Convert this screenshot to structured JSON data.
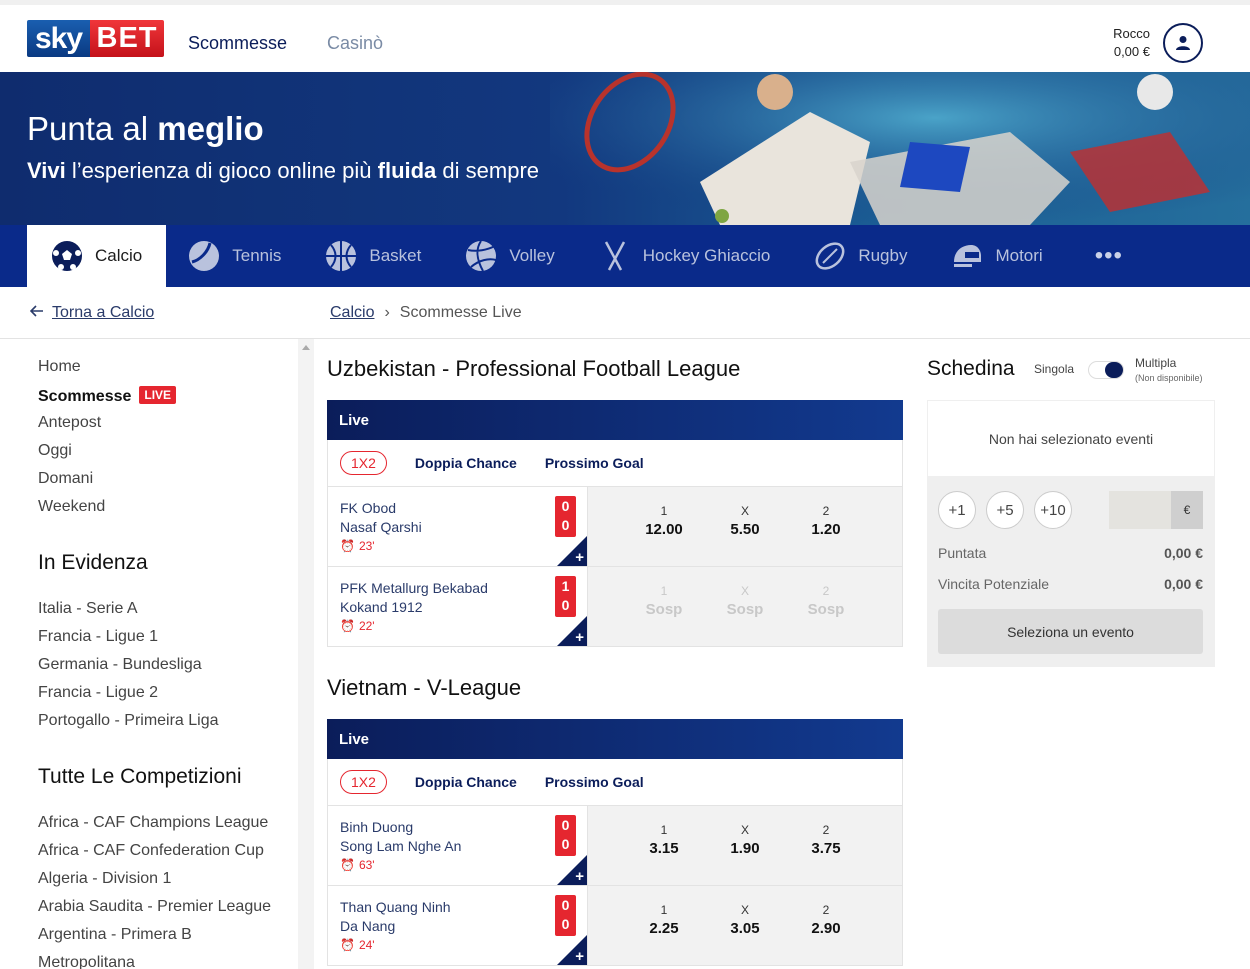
{
  "header": {
    "logo_sky": "sky",
    "logo_bet": "BET",
    "nav_scommesse": "Scommesse",
    "nav_casino": "Casinò",
    "user_name": "Rocco",
    "user_balance": "0,00 €"
  },
  "banner": {
    "title_regular": "Punta al ",
    "title_bold": "meglio",
    "sub_1": "Vivi",
    "sub_2": " l’esperienza di gioco online più ",
    "sub_3": "fluida",
    "sub_4": " di sempre"
  },
  "sports": [
    {
      "label": "Calcio",
      "icon": "football-icon",
      "active": true
    },
    {
      "label": "Tennis",
      "icon": "tennis-icon"
    },
    {
      "label": "Basket",
      "icon": "basketball-icon"
    },
    {
      "label": "Volley",
      "icon": "volleyball-icon"
    },
    {
      "label": "Hockey Ghiaccio",
      "icon": "hockey-icon"
    },
    {
      "label": "Rugby",
      "icon": "rugby-icon"
    },
    {
      "label": "Motori",
      "icon": "helmet-icon"
    }
  ],
  "sports_more": "•••",
  "breadcrumb": {
    "back": "Torna a Calcio",
    "crumb_1": "Calcio",
    "separator": "›",
    "crumb_2": "Scommesse Live"
  },
  "sidebar": {
    "items": [
      "Home",
      "Scommesse",
      "Antepost",
      "Oggi",
      "Domani",
      "Weekend"
    ],
    "live_badge": "LIVE",
    "heading_evidenza": "In Evidenza",
    "evidenza": [
      "Italia - Serie A",
      "Francia - Ligue 1",
      "Germania - Bundesliga",
      "Francia - Ligue 2",
      "Portogallo - Primeira Liga"
    ],
    "heading_tutte": "Tutte Le Competizioni",
    "competizioni": [
      "Africa - CAF Champions League",
      "Africa - CAF Confederation Cup",
      "Algeria - Division 1",
      "Arabia Saudita - Premier League",
      "Argentina - Primera B",
      "Metropolitana"
    ]
  },
  "tabs": {
    "t1": "1X2",
    "t2": "Doppia Chance",
    "t3": "Prossimo Goal"
  },
  "live_label": "Live",
  "leagues": [
    {
      "title": "Uzbekistan - Professional Football League",
      "matches": [
        {
          "home": "FK Obod",
          "away": "Nasaf Qarshi",
          "minute": "23'",
          "score_home": "0",
          "score_away": "0",
          "odds": [
            {
              "label": "1",
              "value": "12.00"
            },
            {
              "label": "X",
              "value": "5.50"
            },
            {
              "label": "2",
              "value": "1.20"
            }
          ],
          "suspended": false
        },
        {
          "home": "PFK Metallurg Bekabad",
          "away": "Kokand 1912",
          "minute": "22'",
          "score_home": "1",
          "score_away": "0",
          "odds": [
            {
              "label": "1",
              "value": "Sosp"
            },
            {
              "label": "X",
              "value": "Sosp"
            },
            {
              "label": "2",
              "value": "Sosp"
            }
          ],
          "suspended": true
        }
      ]
    },
    {
      "title": "Vietnam - V-League",
      "matches": [
        {
          "home": "Binh Duong",
          "away": "Song Lam Nghe An",
          "minute": "63'",
          "score_home": "0",
          "score_away": "0",
          "odds": [
            {
              "label": "1",
              "value": "3.15"
            },
            {
              "label": "X",
              "value": "1.90"
            },
            {
              "label": "2",
              "value": "3.75"
            }
          ],
          "suspended": false
        },
        {
          "home": "Than Quang Ninh",
          "away": "Da Nang",
          "minute": "24'",
          "score_home": "0",
          "score_away": "0",
          "odds": [
            {
              "label": "1",
              "value": "2.25"
            },
            {
              "label": "X",
              "value": "3.05"
            },
            {
              "label": "2",
              "value": "2.90"
            }
          ],
          "suspended": false
        }
      ]
    }
  ],
  "betslip": {
    "title": "Schedina",
    "singola": "Singola",
    "multipla": "Multipla",
    "multipla_sub": "(Non disponibile)",
    "empty": "Non hai selezionato eventi",
    "chip_1": "+1",
    "chip_5": "+5",
    "chip_10": "+10",
    "currency": "€",
    "puntata_label": "Puntata",
    "puntata_value": "0,00 €",
    "vincita_label": "Vincita Potenziale",
    "vincita_value": "0,00 €",
    "button": "Seleziona un evento"
  },
  "colors": {
    "brand_navy": "#0b1d5a",
    "live_red": "#e5262f"
  }
}
